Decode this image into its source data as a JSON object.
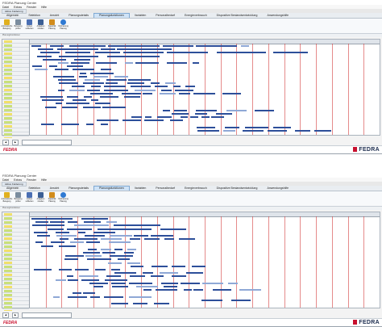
{
  "window": {
    "title": "FEDRA Planung Center",
    "menu": [
      "Datei",
      "Extras",
      "Fenster",
      "Hilfe"
    ],
    "workspace_tab": "Aktive Felderung"
  },
  "ribbon": {
    "tabs": [
      "Allgemein",
      "Selektion",
      "Ansicht",
      "Planungsdetails",
      "Planungsfunktionen",
      "Variablen",
      "Personalbedarf",
      "Energieverbrauch",
      "Dispositive Bestandsentwicklung",
      "Anwendungshilfe"
    ],
    "active_tab": "Planungsfunktionen",
    "buttons": [
      {
        "label": "Automatische Belegung",
        "icon": "auto-assign-icon",
        "color": "#e0b020"
      },
      {
        "label": "Belegung prüfen",
        "icon": "check-icon",
        "color": "#7a8c9e"
      },
      {
        "label": "Lücken schließen",
        "icon": "gap-close-icon",
        "color": "#4a6fb3"
      },
      {
        "label": "Aufgaben zuteilen",
        "icon": "distribute-icon",
        "color": "#3b5f95"
      },
      {
        "label": "Kapazität Planung",
        "icon": "capacity-icon",
        "color": "#d28c1c"
      },
      {
        "label": "Optimierung Planung",
        "icon": "optimize-icon",
        "color": "#2f7ad3"
      }
    ],
    "group_label": "Planungsfunktionen"
  },
  "colors": {
    "gantt_bar": "#2d4f9a",
    "gantt_bar_light": "#8fa8d6",
    "day_line": "#cf2b2b",
    "swatch_green": "#c9e07a",
    "swatch_yellow": "#f1e06a",
    "brand_red": "#c8102e",
    "brand_navy": "#1b2c4e"
  },
  "status": {
    "logo": "FEDRA",
    "brand": "FEDRA"
  }
}
